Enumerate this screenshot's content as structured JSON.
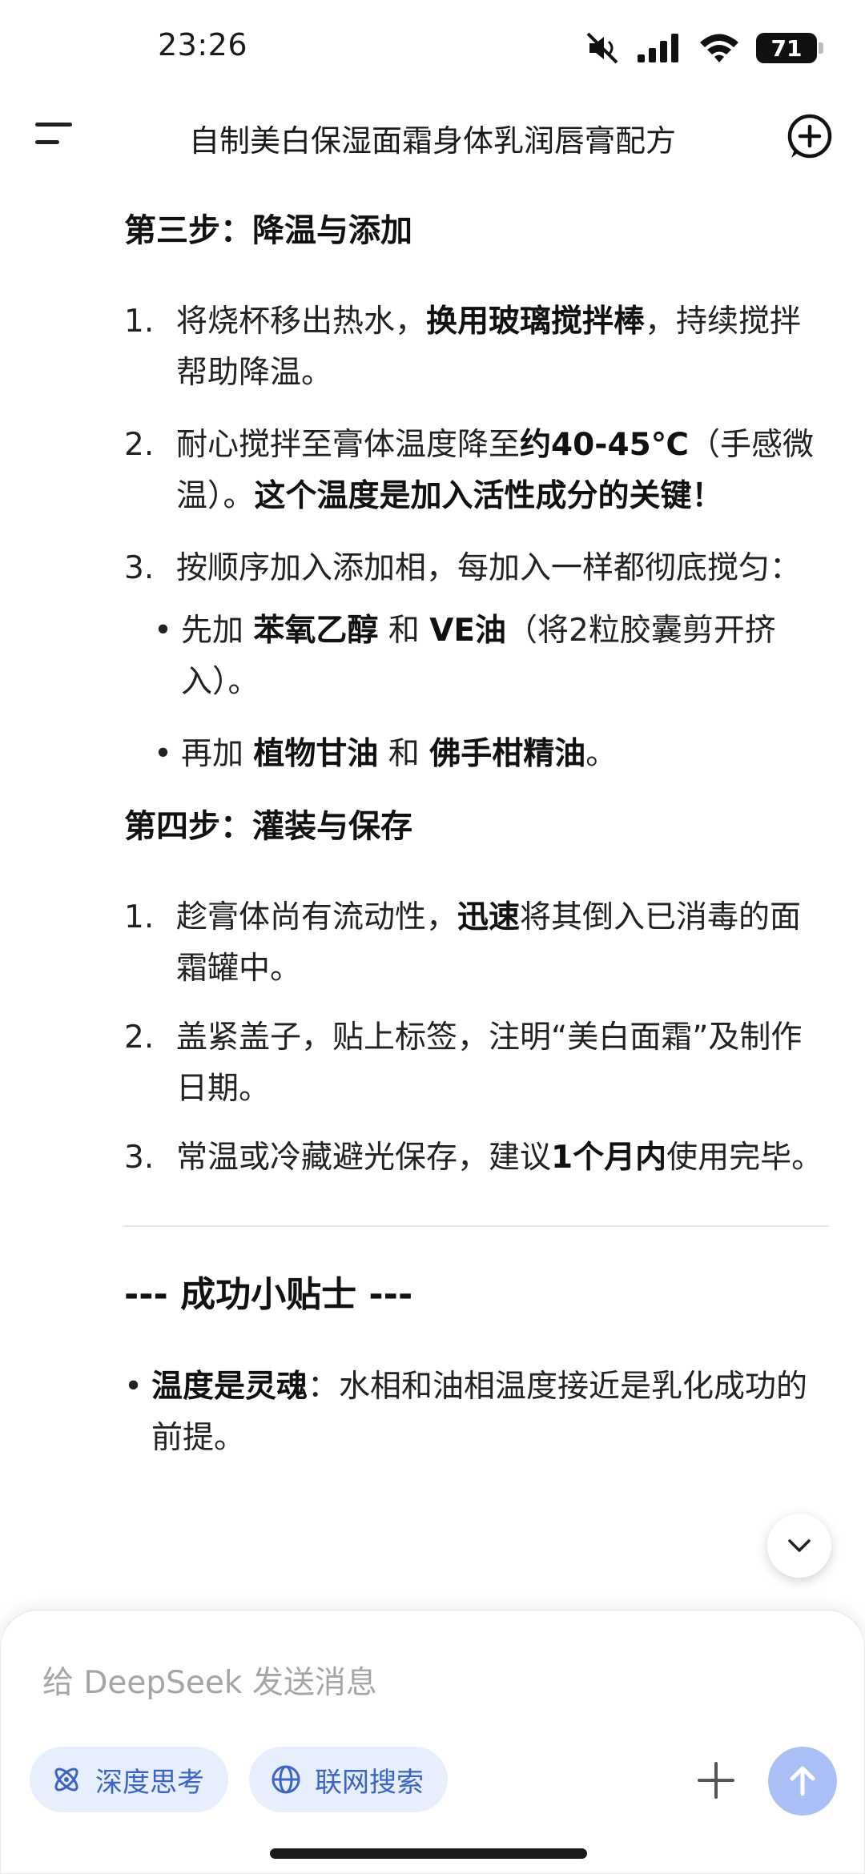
{
  "status_bar": {
    "time": "23:26",
    "battery": "71"
  },
  "header": {
    "title": "自制美白保湿面霜身体乳润唇膏配方"
  },
  "step3": {
    "heading": "第三步：降温与添加",
    "items": [
      {
        "num": "1.",
        "p1": "将烧杯移出热水，",
        "b1": "换用玻璃搅拌棒",
        "p2": "，持续搅拌帮助降温。"
      },
      {
        "num": "2.",
        "p1": "耐心搅拌至膏体温度降至",
        "b1": "约40-45℃",
        "p2": "（手感微温）。",
        "b2": "这个温度是加入活性成分的关键！"
      },
      {
        "num": "3.",
        "p1": "按顺序加入添加相，每加入一样都彻底搅匀："
      }
    ],
    "bullets": [
      {
        "p1": "先加 ",
        "b1": "苯氧乙醇",
        "p2": " 和 ",
        "b2": "VE油",
        "p3": "（将2粒胶囊剪开挤入）。"
      },
      {
        "p1": "再加 ",
        "b1": "植物甘油",
        "p2": " 和 ",
        "b2": "佛手柑精油",
        "p3": "。"
      }
    ]
  },
  "step4": {
    "heading": "第四步：灌装与保存",
    "items": [
      {
        "num": "1.",
        "p1": "趁膏体尚有流动性，",
        "b1": "迅速",
        "p2": "将其倒入已消毒的面霜罐中。"
      },
      {
        "num": "2.",
        "p1": "盖紧盖子，贴上标签，注明“美白面霜”及制作日期。"
      },
      {
        "num": "3.",
        "p1": "常温或冷藏避光保存，建议",
        "b1": "1个月内",
        "p2": "使用完毕。"
      }
    ]
  },
  "tips": {
    "heading": "--- 成功小贴士 ---",
    "bullets": [
      {
        "b1": "温度是灵魂",
        "p1": "：水相和油相温度接近是乳化成功的前提。"
      }
    ]
  },
  "composer": {
    "placeholder": "给 DeepSeek 发送消息",
    "deep_think": "深度思考",
    "web_search": "联网搜索"
  },
  "colors": {
    "accent": "#3a64c9",
    "pill_bg": "#e7eefc",
    "send_bg": "#a9bff6"
  },
  "icons": [
    "mute-icon",
    "signal-icon",
    "wifi-icon",
    "battery-icon",
    "menu-icon",
    "new-chat-icon",
    "chevron-down-icon",
    "atom-icon",
    "globe-icon",
    "plus-icon",
    "arrow-up-icon"
  ]
}
